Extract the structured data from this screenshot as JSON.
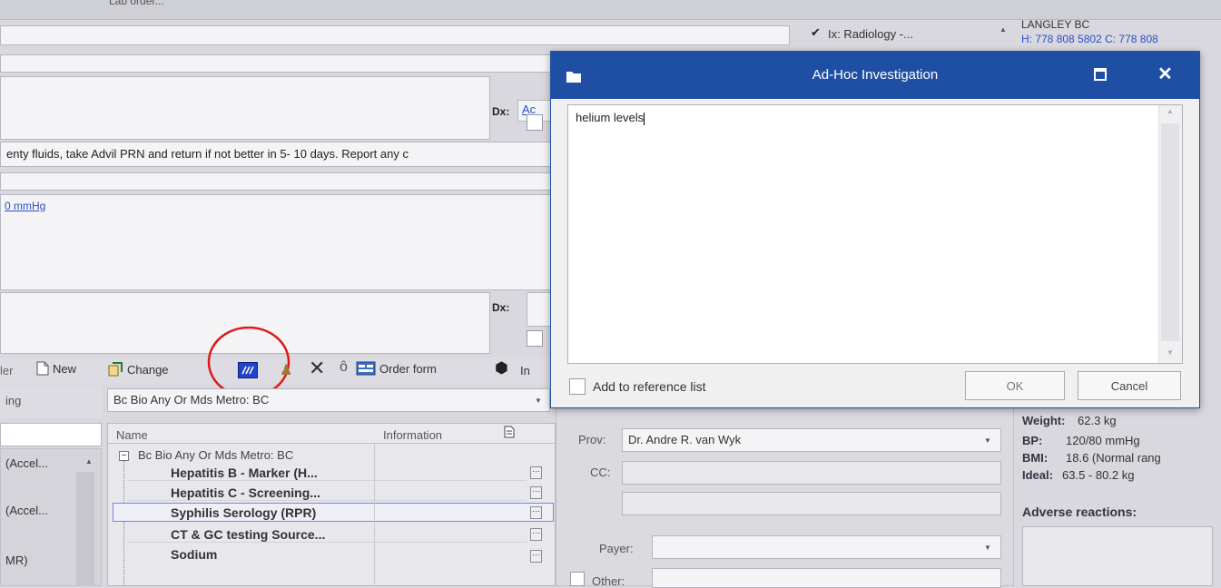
{
  "top_toolbar": {
    "fragment_text": "Lab order..."
  },
  "chart_header": {
    "investigation_item": "Ix: Radiology -...",
    "location": "LANGLEY BC",
    "phone": "H: 778 808 5802 C: 778 808"
  },
  "plan_text": "enty fluids, take Advil PRN and return if not better in 5- 10 days. Report any c",
  "vitals_link": "0 mmHg",
  "dx_label_1": "Dx:",
  "dx_value_1": "Ac",
  "dx_label_2": "Dx:",
  "toolbar": {
    "lab_fragment": "ler",
    "new_label": "New",
    "change_label": "Change",
    "order_form_label": "Order form",
    "in_fragment": "In"
  },
  "left_panel": {
    "header_fragment": "ing",
    "items": [
      "(Accel...",
      "(Accel...",
      "MR)"
    ]
  },
  "lab_panel": {
    "dropdown_value": "Bc Bio Any Or Mds Metro: BC",
    "columns": {
      "name": "Name",
      "information": "Information"
    },
    "group": "Bc Bio Any Or Mds Metro: BC",
    "rows": [
      "Hepatitis B - Marker (H...",
      "Hepatitis C - Screening...",
      "Syphilis Serology (RPR)",
      "CT & GC testing Source...",
      "Sodium"
    ]
  },
  "order_form": {
    "prov_label": "Prov:",
    "prov_value": "Dr. Andre R. van Wyk",
    "cc_label": "CC:",
    "payer_label": "Payer:",
    "other_label": "Other:"
  },
  "vitals": {
    "weight_label": "Weight:",
    "weight_value": "62.3 kg",
    "bp_label": "BP:",
    "bp_value": "120/80 mmHg",
    "bmi_label": "BMI:",
    "bmi_value": "18.6 (Normal rang",
    "ideal_label": "Ideal:",
    "ideal_value": "63.5 - 80.2 kg",
    "adverse_label": "Adverse reactions:"
  },
  "dialog": {
    "title": "Ad-Hoc Investigation",
    "text_value": "helium levels",
    "add_to_reference_label": "Add to reference list",
    "ok_label": "OK",
    "cancel_label": "Cancel"
  },
  "colors": {
    "dialog_titlebar": "#1f4fa4",
    "annotation_circle": "#e01818",
    "link": "#2b4fc9"
  }
}
